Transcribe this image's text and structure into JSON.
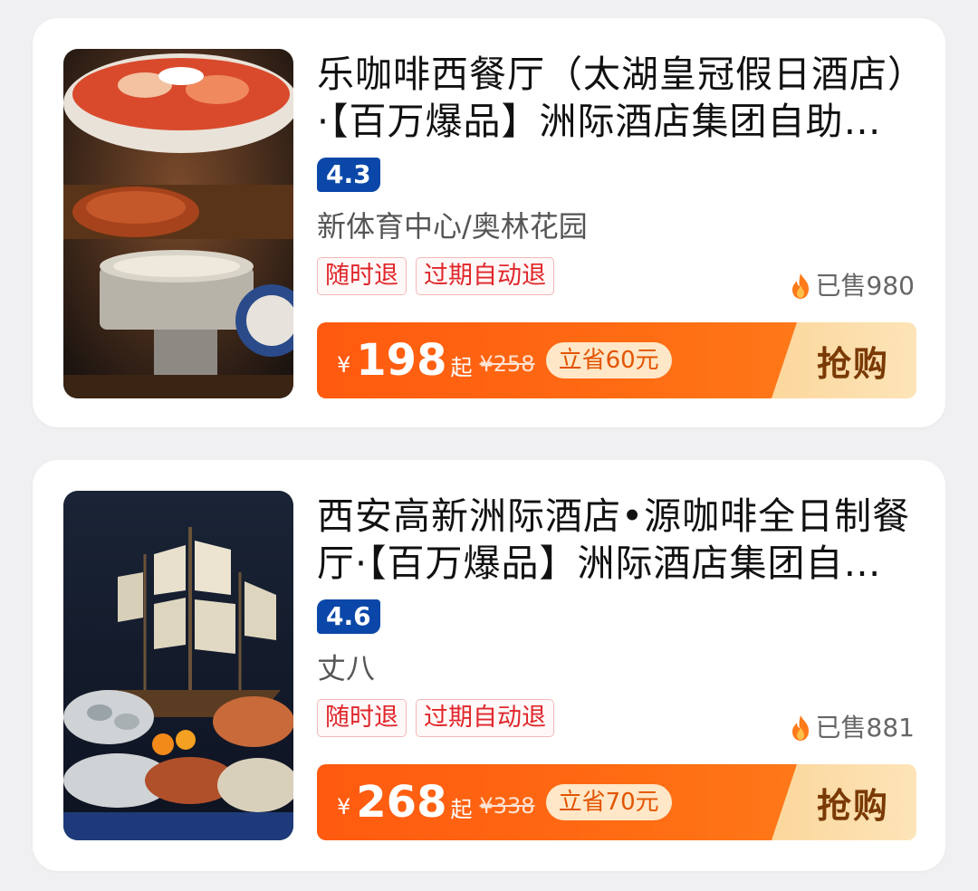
{
  "deals": [
    {
      "title": "乐咖啡西餐厅（太湖皇冠假日酒店）·【百万爆品】洲际酒店集团自助午餐/晚餐",
      "rating": "4.3",
      "area": "新体育中心/奥林花园",
      "tags": [
        "随时退",
        "过期自动退"
      ],
      "sold": "已售980",
      "currency": "¥",
      "price": "198",
      "price_suffix": "起",
      "original_price": "¥258",
      "saving": "立省60元",
      "buy_label": "抢购"
    },
    {
      "title": "西安高新洲际酒店•源咖啡全日制餐厅·【百万爆品】洲际酒店集团自助午餐/晚餐",
      "rating": "4.6",
      "area": "丈八",
      "tags": [
        "随时退",
        "过期自动退"
      ],
      "sold": "已售881",
      "currency": "¥",
      "price": "268",
      "price_suffix": "起",
      "original_price": "¥338",
      "saving": "立省70元",
      "buy_label": "抢购"
    }
  ],
  "icons": {
    "fire": "fire-icon",
    "thumbnail_1": "buffet-food-photo",
    "thumbnail_2": "seafood-ship-photo"
  },
  "colors": {
    "accent_orange": "#ff5a10",
    "rating_blue": "#0a47a8",
    "tag_red": "#e0262b",
    "buy_button": "#fbd79c"
  }
}
